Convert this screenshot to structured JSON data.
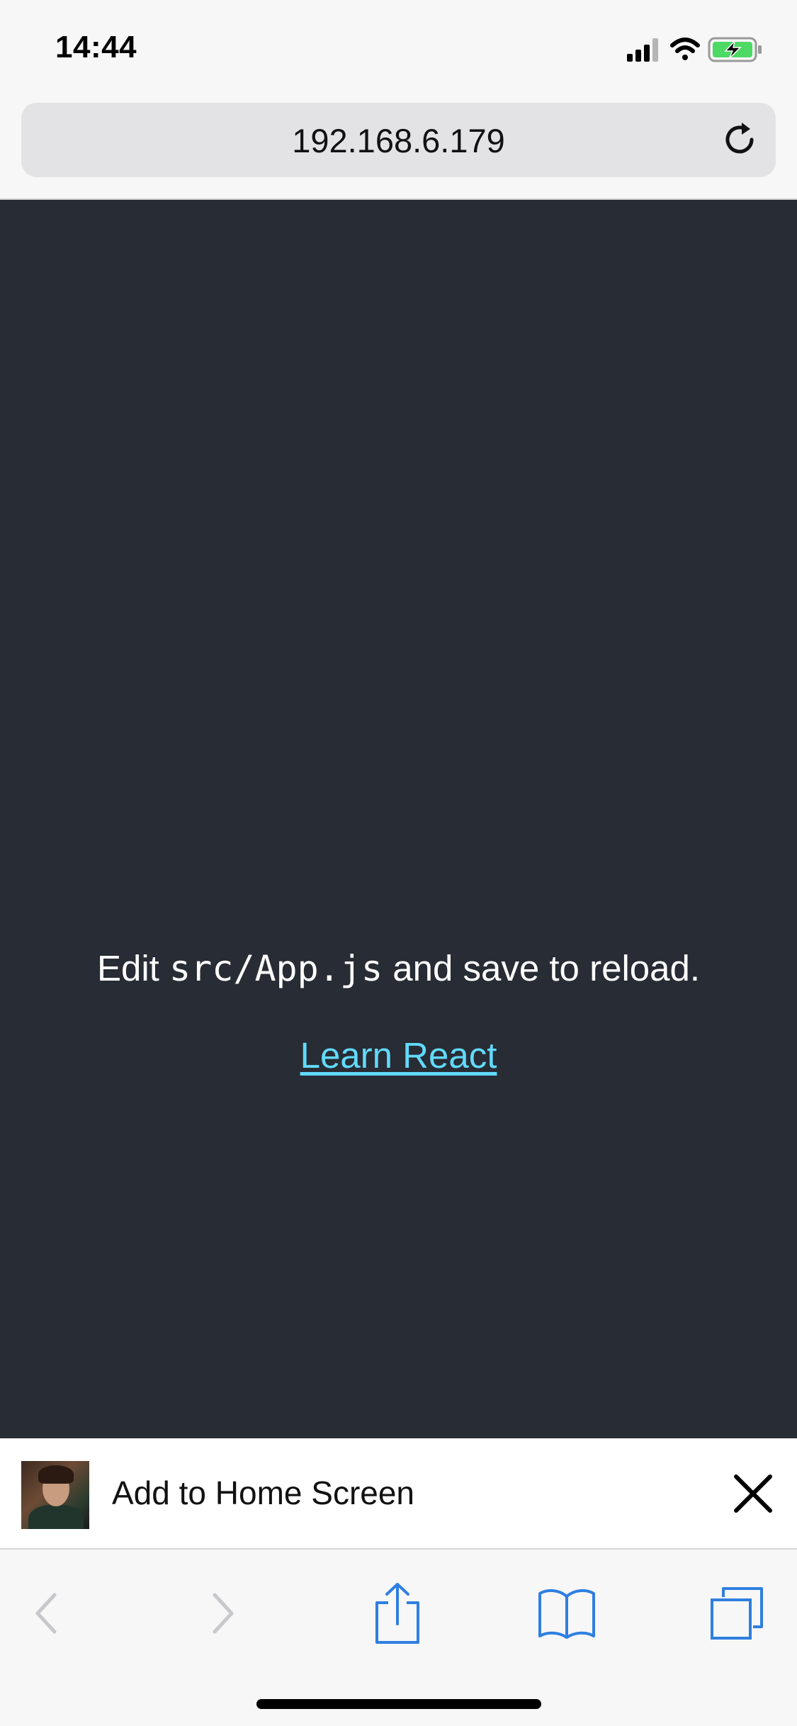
{
  "status_bar": {
    "time": "14:44",
    "icons": [
      "cellular-signal-icon",
      "wifi-icon",
      "battery-charging-icon"
    ]
  },
  "address_bar": {
    "url": "192.168.6.179",
    "reload_icon": "reload-icon"
  },
  "page": {
    "edit_prefix": "Edit ",
    "edit_code": "src/App.js",
    "edit_suffix": " and save to reload.",
    "link_label": "Learn React",
    "background_color": "#282c34",
    "link_color": "#61dafb"
  },
  "banner": {
    "label": "Add to Home Screen",
    "close_icon": "close-icon"
  },
  "toolbar": {
    "buttons": [
      "back-icon",
      "forward-icon",
      "share-icon",
      "bookmarks-icon",
      "tabs-icon"
    ],
    "accent_color": "#2f7fe0",
    "disabled_color": "#c7c7cc"
  }
}
